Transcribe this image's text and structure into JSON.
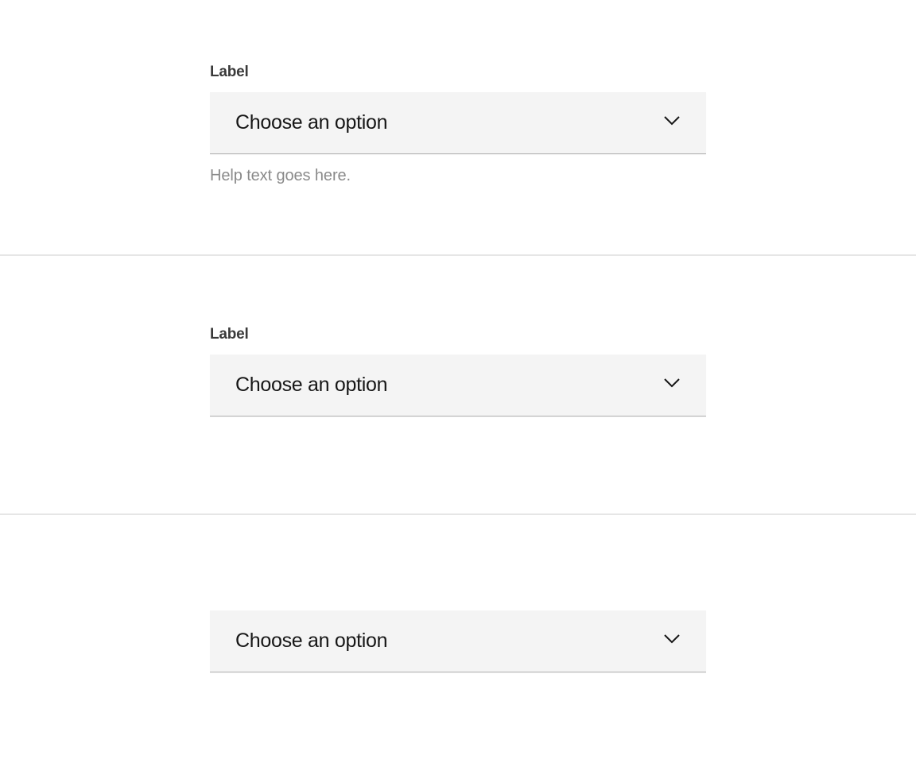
{
  "variants": [
    {
      "label": "Label",
      "placeholder": "Choose an option",
      "help": "Help text goes here."
    },
    {
      "label": "Label",
      "placeholder": "Choose an option"
    },
    {
      "placeholder": "Choose an option"
    }
  ]
}
